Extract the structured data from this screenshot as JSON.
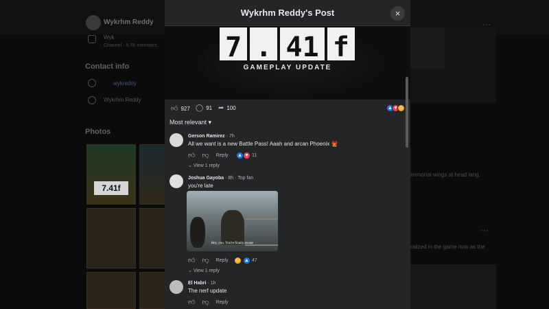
{
  "background": {
    "page_name": "Wykrhm Reddy",
    "channel_name": "Wyk",
    "channel_members": "Channel · 4.7K members",
    "contact_heading": "Contact info",
    "contact_links": [
      "wykreddy",
      "wykr"
    ],
    "contact_name": "Wykrhm Reddy",
    "photos_heading": "Photos",
    "photo_tile_text": "7.41f",
    "right_post_text_1": "immortal wings at head lang.",
    "right_post_text_2": "ralized in the game now as the"
  },
  "modal": {
    "title": "Wykrhm Reddy's Post",
    "close_label": "×",
    "hero": {
      "big_text": [
        "7",
        ".",
        "41",
        "f"
      ],
      "subtitle": "GAMEPLAY UPDATE"
    },
    "stats": {
      "likes": "927",
      "comments": "91",
      "shares": "100"
    },
    "sort_label": "Most relevant",
    "comments": [
      {
        "name": "Gerson Ramirez",
        "time": "7h",
        "text": "All we want is a new Battle Pass! Aaah and arcan Phoenix 🐦‍🔥",
        "reply_label": "Reply",
        "reaction_count": "11",
        "view_replies": "View 1 reply"
      },
      {
        "name": "Joshua Gayoba",
        "time": "8h",
        "badge": "Top fan",
        "text": "you're late",
        "meme_caption": "Hey, you. You're finally awake",
        "reply_label": "Reply",
        "reaction_count": "47",
        "view_replies": "View 1 reply"
      },
      {
        "name": "El Habri",
        "time": "1h",
        "text": "The nerf update",
        "reply_label": "Reply"
      }
    ]
  },
  "colors": {
    "modal_bg": "#242526",
    "like_blue": "#1877f2",
    "love_red": "#f33e58",
    "haha_yellow": "#f7b125"
  }
}
